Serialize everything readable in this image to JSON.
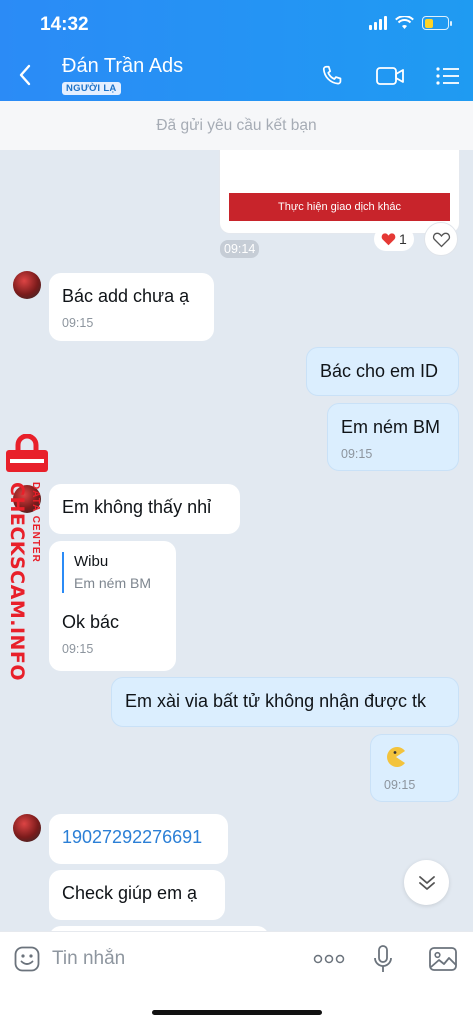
{
  "status": {
    "time": "14:32"
  },
  "header": {
    "contact_name": "Đán Trần Ads",
    "badge": "NGƯỜI LẠ",
    "icons": [
      "back-arrow-icon",
      "phone-icon",
      "video-call-icon",
      "menu-list-icon"
    ]
  },
  "friend_request": {
    "text": "Đã gửi yêu cầu kết bạn"
  },
  "chat": {
    "card": {
      "button_label": "Thực hiện giao dịch khác",
      "time": "09:14",
      "reaction_count": "1"
    },
    "messages": [
      {
        "dir": "in",
        "text": "Bác add chưa ạ",
        "time": "09:15"
      },
      {
        "dir": "out",
        "text": "Bác cho em ID"
      },
      {
        "dir": "out",
        "text": "Em ném BM",
        "time": "09:15"
      },
      {
        "dir": "in",
        "text": "Em không thấy nhỉ"
      },
      {
        "dir": "in",
        "quote_name": "Wibu",
        "quote_text": "Em ném BM",
        "text": "Ok bác",
        "time": "09:15"
      },
      {
        "dir": "out",
        "text": "Em xài via bất tử không nhận được tk"
      },
      {
        "dir": "out",
        "sticker": "pacman-sticker",
        "time": "09:15"
      },
      {
        "dir": "in",
        "text": "19027292276691"
      },
      {
        "dir": "in",
        "text": "Check giúp em ạ"
      }
    ]
  },
  "watermark": {
    "main": "CHECKSCAM.INFO",
    "sub": "DATA CENTER"
  },
  "input": {
    "placeholder": "Tin nhắn"
  },
  "colors": {
    "header": "#2b8bf6",
    "outgoing_bubble": "#dbeefe",
    "incoming_bubble": "#ffffff",
    "chat_bg": "#e2e9f1",
    "watermark": "#e8202a"
  }
}
